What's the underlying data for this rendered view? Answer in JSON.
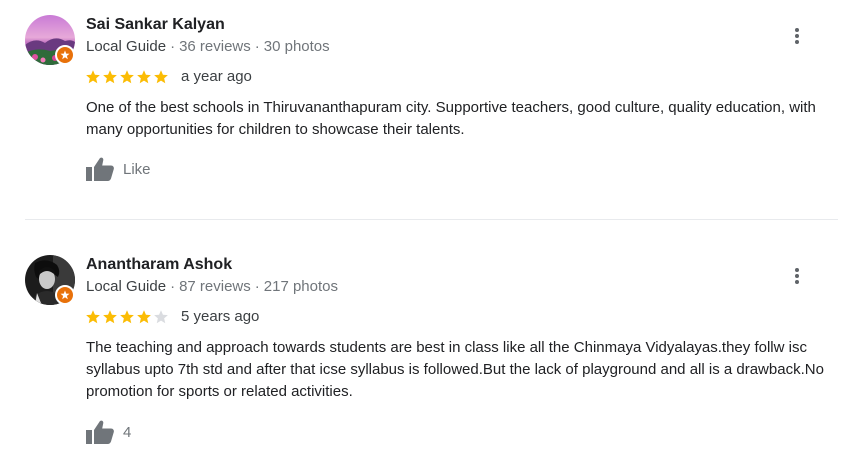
{
  "reviews": [
    {
      "author": "Sai Sankar Kalyan",
      "guide_label": "Local Guide",
      "reviews_count": "36 reviews",
      "photos_count": "30 photos",
      "rating": 5,
      "time": "a year ago",
      "text": "One of the best schools in Thiruvananthapuram city. Supportive teachers, good culture, quality education, with many opportunities for children to showcase their talents.",
      "like_label": "Like",
      "avatar_icon": "landscape-avatar"
    },
    {
      "author": "Anantharam Ashok",
      "guide_label": "Local Guide",
      "reviews_count": "87 reviews",
      "photos_count": "217 photos",
      "rating": 4,
      "time": "5 years ago",
      "text": "The teaching and approach towards students are best in class like all the Chinmaya Vidyalayas.they follw isc syllabus upto 7th std and after that icse syllabus is followed.But the lack of playground and all is a drawback.No promotion for sports or related activities.",
      "like_label": "4",
      "avatar_icon": "person-avatar"
    }
  ],
  "colors": {
    "star_filled": "#fbbc04",
    "star_empty": "#dadce0",
    "guide_badge": "#e8710a",
    "icon_gray": "#70757a"
  }
}
